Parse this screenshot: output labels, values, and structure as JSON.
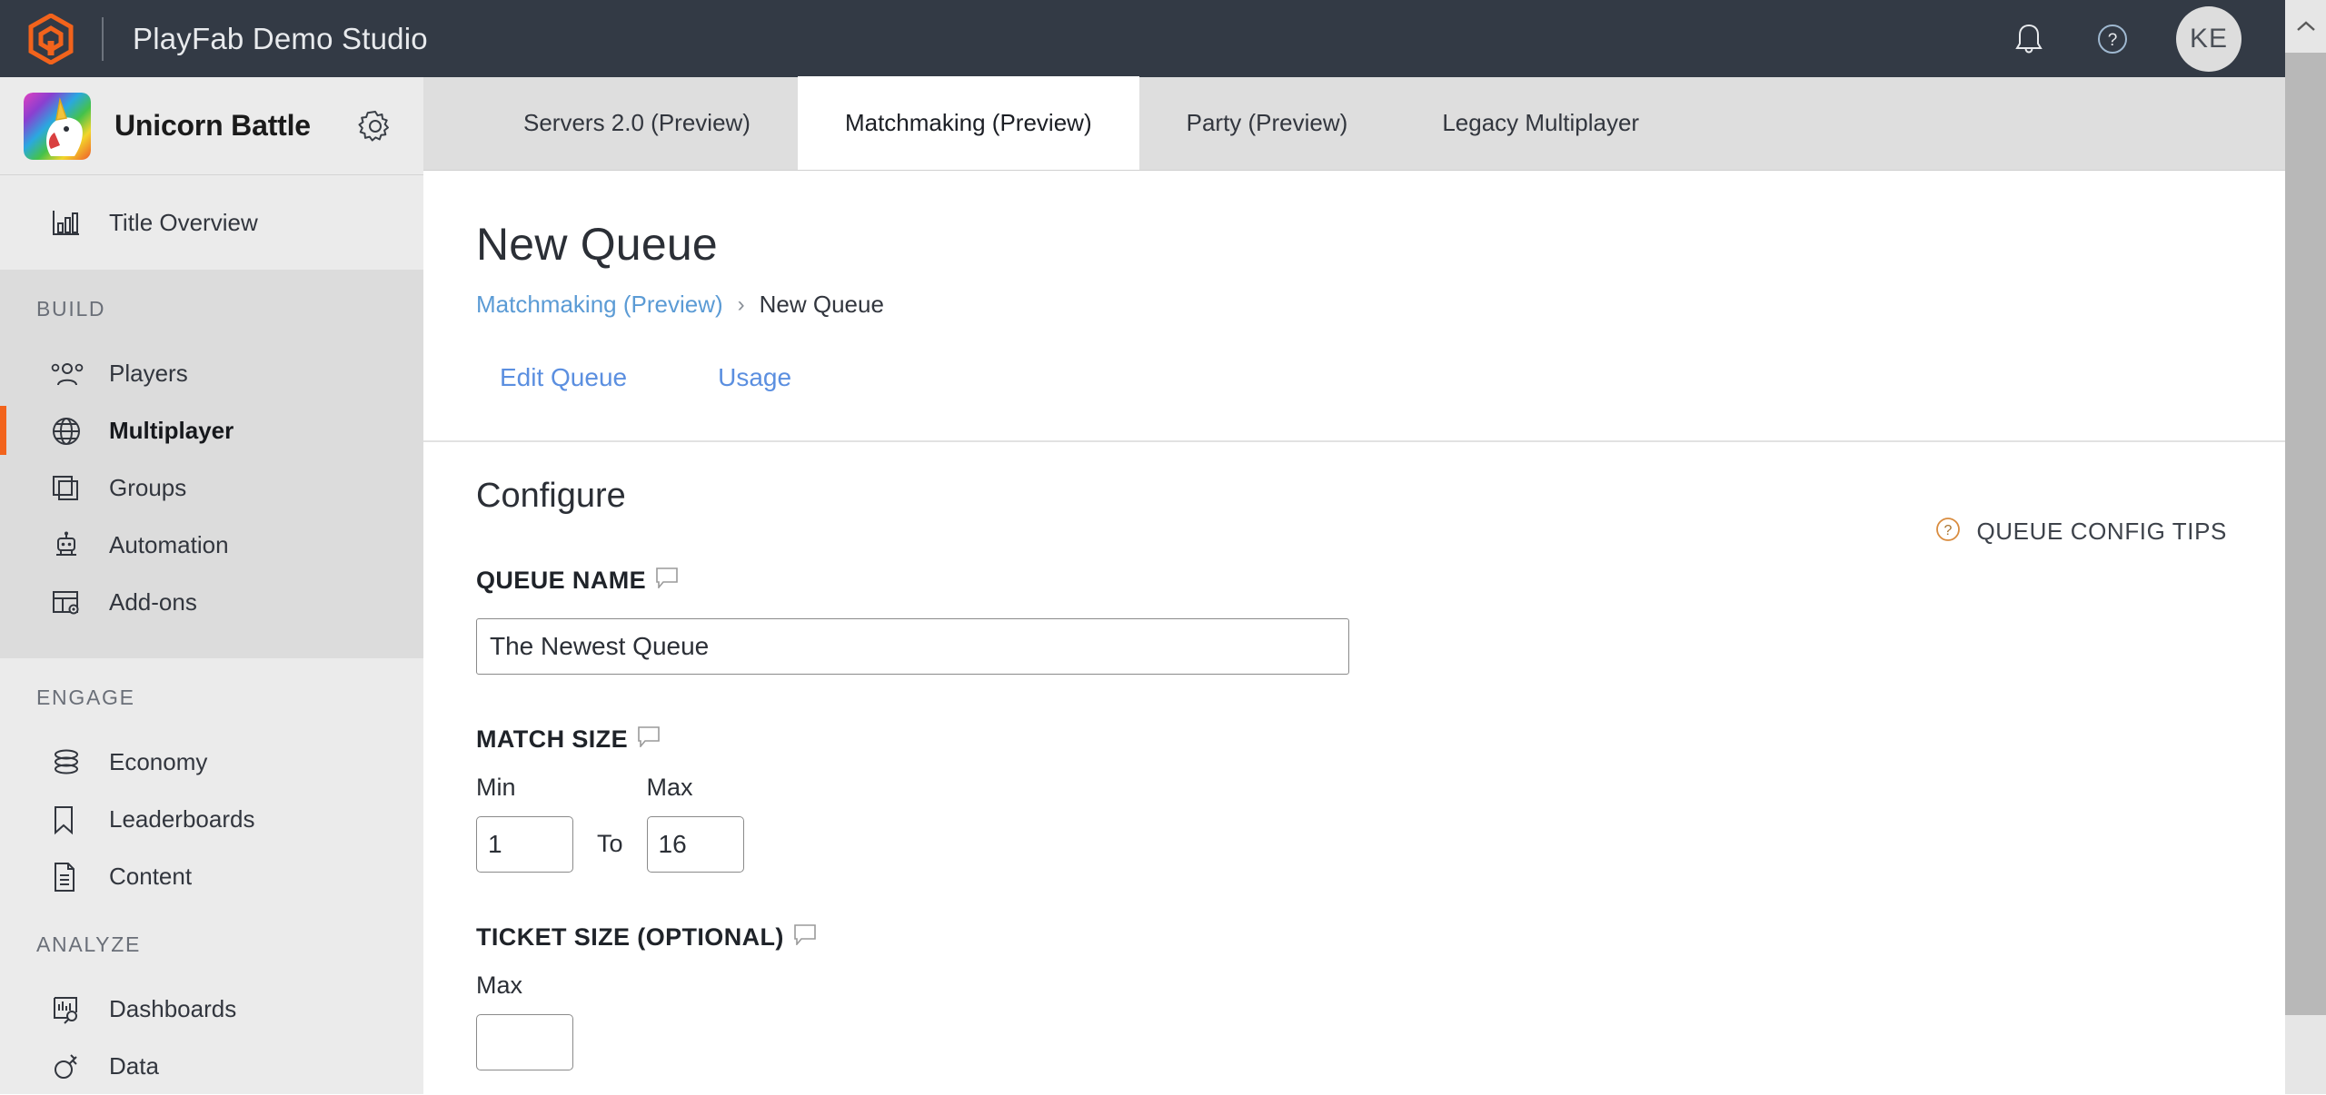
{
  "topbar": {
    "logo_icon": "playfab-hex-logo-icon",
    "app_title": "PlayFab Demo Studio",
    "notifications_icon": "bell-icon",
    "help_icon": "help-circle-icon",
    "avatar_initials": "KE",
    "accent_color": "#f2631c",
    "background_color": "#333a45"
  },
  "sidebar": {
    "title_thumb_icon": "unicorn-title-thumbnail",
    "title_name": "Unicorn Battle",
    "settings_icon": "gear-icon",
    "overview": {
      "label": "Title Overview",
      "icon": "bar-chart-icon"
    },
    "groups": [
      {
        "label": "BUILD",
        "shaded": true,
        "items": [
          {
            "label": "Players",
            "icon": "people-icon",
            "active": false
          },
          {
            "label": "Multiplayer",
            "icon": "globe-icon",
            "active": true
          },
          {
            "label": "Groups",
            "icon": "stacked-squares-icon",
            "active": false
          },
          {
            "label": "Automation",
            "icon": "robot-icon",
            "active": false
          },
          {
            "label": "Add-ons",
            "icon": "addons-grid-gear-icon",
            "active": false
          }
        ]
      },
      {
        "label": "ENGAGE",
        "shaded": false,
        "items": [
          {
            "label": "Economy",
            "icon": "coins-stack-icon",
            "active": false
          },
          {
            "label": "Leaderboards",
            "icon": "bookmark-icon",
            "active": false
          },
          {
            "label": "Content",
            "icon": "document-icon",
            "active": false
          }
        ]
      },
      {
        "label": "ANALYZE",
        "shaded": false,
        "items": [
          {
            "label": "Dashboards",
            "icon": "chart-search-icon",
            "active": false
          },
          {
            "label": "Data",
            "icon": "plug-icon",
            "active": false
          }
        ]
      }
    ]
  },
  "tabs": [
    {
      "label": "Servers 2.0 (Preview)",
      "active": false
    },
    {
      "label": "Matchmaking (Preview)",
      "active": true
    },
    {
      "label": "Party (Preview)",
      "active": false
    },
    {
      "label": "Legacy Multiplayer",
      "active": false
    }
  ],
  "page": {
    "title": "New Queue",
    "breadcrumb": {
      "parent": "Matchmaking (Preview)",
      "separator": "›",
      "current": "New Queue"
    },
    "subtabs": [
      {
        "label": "Edit Queue"
      },
      {
        "label": "Usage"
      }
    ],
    "tips_button": {
      "icon": "help-circle-icon",
      "label": "QUEUE CONFIG TIPS",
      "icon_color": "#d98c3f"
    },
    "section_title": "Configure",
    "fields": {
      "queue_name": {
        "label": "QUEUE NAME",
        "info_icon": "tooltip-bubble-icon",
        "value": "The Newest Queue",
        "placeholder": ""
      },
      "match_size": {
        "label": "MATCH SIZE",
        "info_icon": "tooltip-bubble-icon",
        "min_label": "Min",
        "max_label": "Max",
        "to_label": "To",
        "min_value": "1",
        "max_value": "16"
      },
      "ticket_size": {
        "label": "TICKET SIZE (OPTIONAL)",
        "info_icon": "tooltip-bubble-icon",
        "max_label": "Max"
      }
    }
  },
  "scrollbar": {
    "up_arrow_icon": "chevron-up-icon"
  }
}
